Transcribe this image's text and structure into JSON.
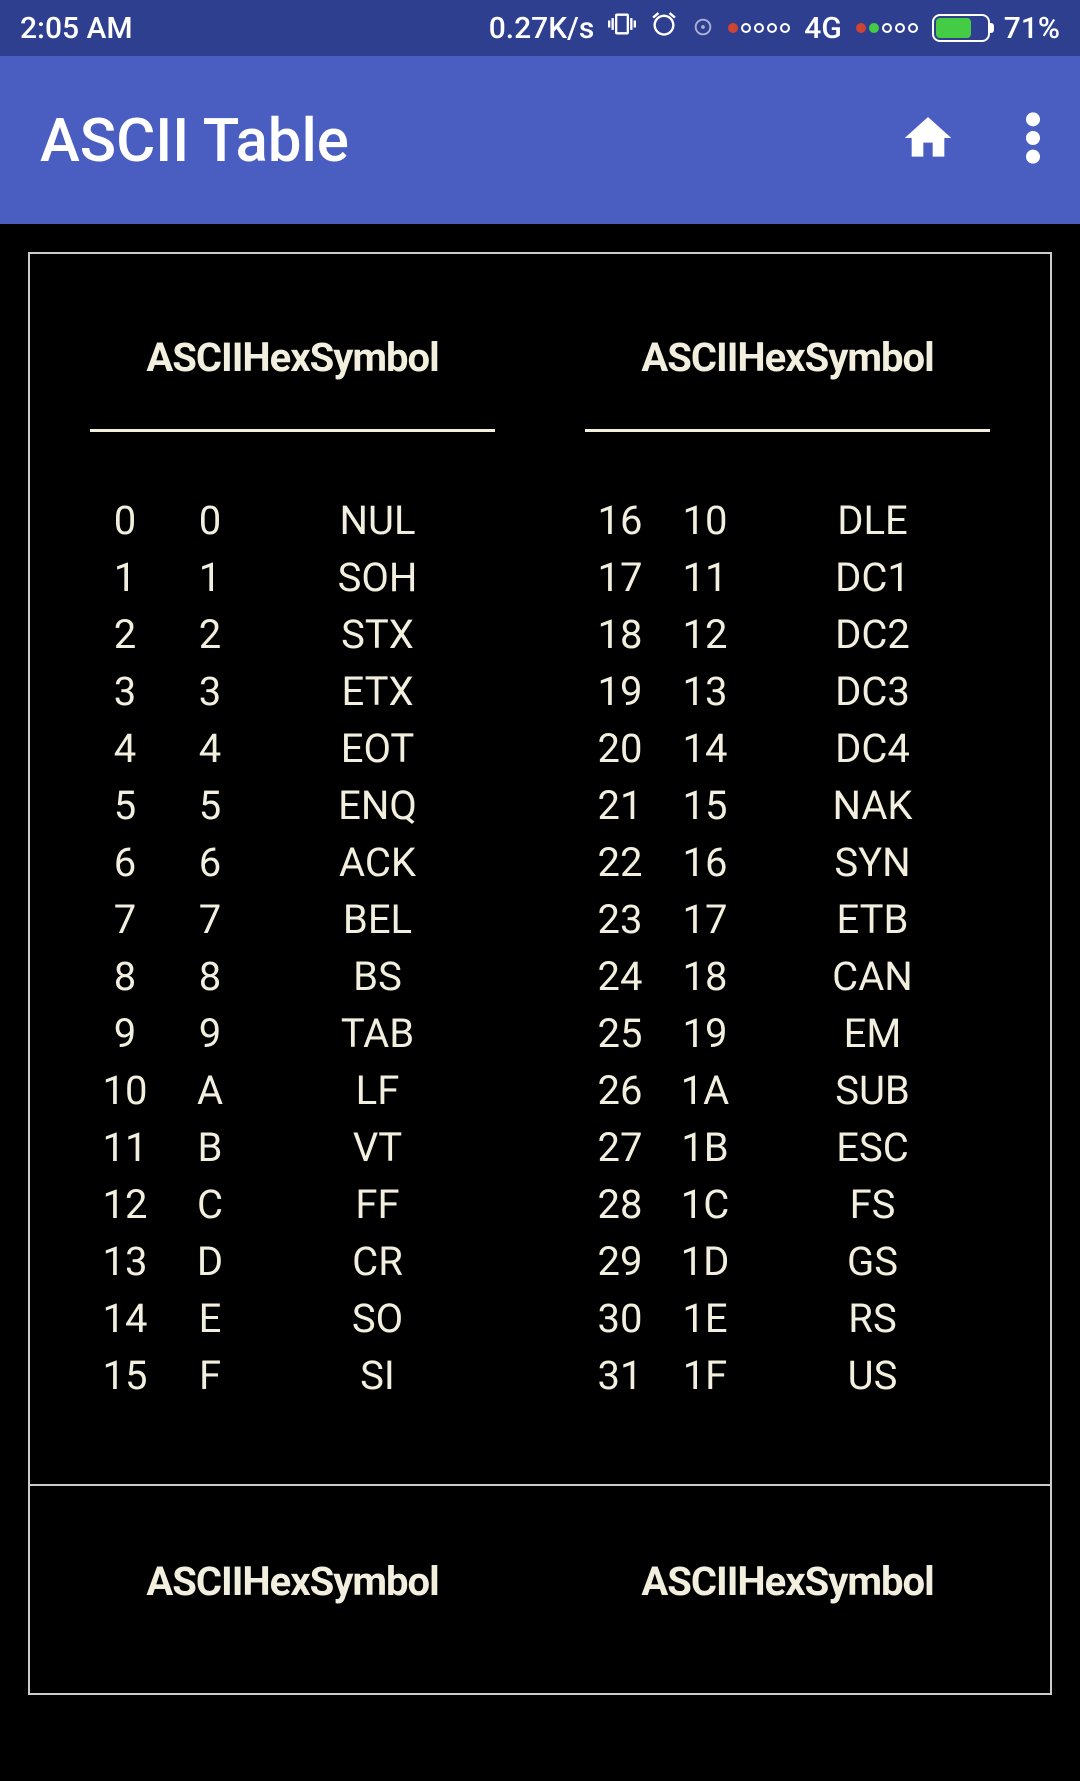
{
  "status": {
    "time": "2:05 AM",
    "speed": "0.27K/s",
    "network": "4G",
    "battery_pct": "71%"
  },
  "app": {
    "title": "ASCII Table"
  },
  "card1": {
    "left": {
      "header": "ASCIIHexSymbol",
      "rows": [
        {
          "a": "0",
          "h": "0",
          "s": "NUL"
        },
        {
          "a": "1",
          "h": "1",
          "s": "SOH"
        },
        {
          "a": "2",
          "h": "2",
          "s": "STX"
        },
        {
          "a": "3",
          "h": "3",
          "s": "ETX"
        },
        {
          "a": "4",
          "h": "4",
          "s": "EOT"
        },
        {
          "a": "5",
          "h": "5",
          "s": "ENQ"
        },
        {
          "a": "6",
          "h": "6",
          "s": "ACK"
        },
        {
          "a": "7",
          "h": "7",
          "s": "BEL"
        },
        {
          "a": "8",
          "h": "8",
          "s": "BS"
        },
        {
          "a": "9",
          "h": "9",
          "s": "TAB"
        },
        {
          "a": "10",
          "h": "A",
          "s": "LF"
        },
        {
          "a": "11",
          "h": "B",
          "s": "VT"
        },
        {
          "a": "12",
          "h": "C",
          "s": "FF"
        },
        {
          "a": "13",
          "h": "D",
          "s": "CR"
        },
        {
          "a": "14",
          "h": "E",
          "s": "SO"
        },
        {
          "a": "15",
          "h": "F",
          "s": "SI"
        }
      ]
    },
    "right": {
      "header": "ASCIIHexSymbol",
      "rows": [
        {
          "a": "16",
          "h": "10",
          "s": "DLE"
        },
        {
          "a": "17",
          "h": "11",
          "s": "DC1"
        },
        {
          "a": "18",
          "h": "12",
          "s": "DC2"
        },
        {
          "a": "19",
          "h": "13",
          "s": "DC3"
        },
        {
          "a": "20",
          "h": "14",
          "s": "DC4"
        },
        {
          "a": "21",
          "h": "15",
          "s": "NAK"
        },
        {
          "a": "22",
          "h": "16",
          "s": "SYN"
        },
        {
          "a": "23",
          "h": "17",
          "s": "ETB"
        },
        {
          "a": "24",
          "h": "18",
          "s": "CAN"
        },
        {
          "a": "25",
          "h": "19",
          "s": "EM"
        },
        {
          "a": "26",
          "h": "1A",
          "s": "SUB"
        },
        {
          "a": "27",
          "h": "1B",
          "s": "ESC"
        },
        {
          "a": "28",
          "h": "1C",
          "s": "FS"
        },
        {
          "a": "29",
          "h": "1D",
          "s": "GS"
        },
        {
          "a": "30",
          "h": "1E",
          "s": "RS"
        },
        {
          "a": "31",
          "h": "1F",
          "s": "US"
        }
      ]
    }
  },
  "card2": {
    "left": {
      "header": "ASCIIHexSymbol"
    },
    "right": {
      "header": "ASCIIHexSymbol"
    }
  }
}
